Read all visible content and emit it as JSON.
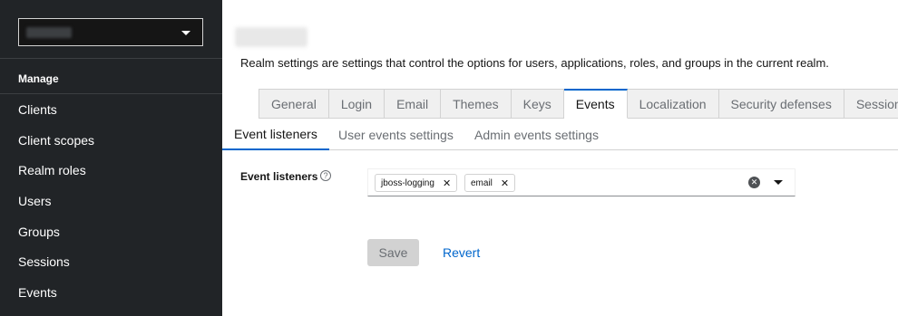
{
  "sidebar": {
    "section_label": "Manage",
    "items": [
      {
        "label": "Clients"
      },
      {
        "label": "Client scopes"
      },
      {
        "label": "Realm roles"
      },
      {
        "label": "Users"
      },
      {
        "label": "Groups"
      },
      {
        "label": "Sessions"
      },
      {
        "label": "Events"
      }
    ]
  },
  "page": {
    "description": "Realm settings are settings that control the options for users, applications, roles, and groups in the current realm."
  },
  "tabs": [
    {
      "label": "General"
    },
    {
      "label": "Login"
    },
    {
      "label": "Email"
    },
    {
      "label": "Themes"
    },
    {
      "label": "Keys"
    },
    {
      "label": "Events",
      "active": true
    },
    {
      "label": "Localization"
    },
    {
      "label": "Security defenses"
    },
    {
      "label": "Sessions"
    }
  ],
  "subtabs": [
    {
      "label": "Event listeners",
      "active": true
    },
    {
      "label": "User events settings"
    },
    {
      "label": "Admin events settings"
    }
  ],
  "form": {
    "event_listeners_label": "Event listeners",
    "help_glyph": "?",
    "chips": [
      {
        "label": "jboss-logging"
      },
      {
        "label": "email"
      }
    ],
    "chip_remove_glyph": "✕",
    "clear_glyph": "✕"
  },
  "actions": {
    "save_label": "Save",
    "revert_label": "Revert"
  },
  "colors": {
    "sidebar_bg": "#212427",
    "accent": "#0066cc",
    "tab_bg": "#f0f0f0"
  },
  "icons": {
    "realm_dropdown": "caret-down-icon",
    "help": "question-circle-icon",
    "chip_remove": "times-icon",
    "clear": "times-circle-icon",
    "toggle": "caret-down-icon"
  }
}
